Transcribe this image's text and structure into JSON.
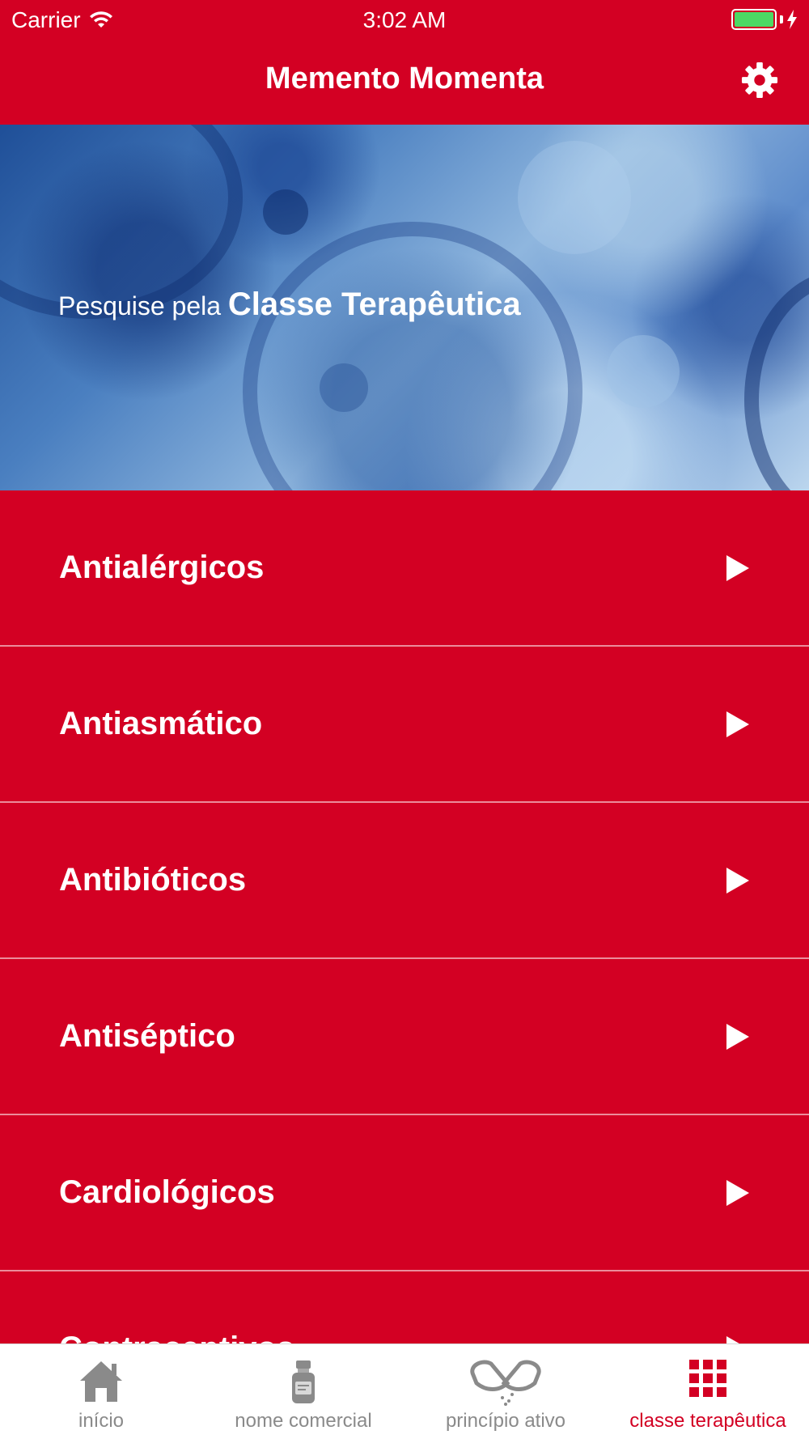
{
  "status_bar": {
    "carrier": "Carrier",
    "time": "3:02 AM"
  },
  "nav": {
    "title": "Memento Momenta",
    "settings_icon": "gear-icon"
  },
  "hero": {
    "prefix": "Pesquise pela",
    "emphasis": "Classe Terapêutica"
  },
  "list": {
    "items": [
      {
        "label": "Antialérgicos"
      },
      {
        "label": "Antiasmático"
      },
      {
        "label": "Antibióticos"
      },
      {
        "label": "Antiséptico"
      },
      {
        "label": "Cardiológicos"
      },
      {
        "label": "Contraceptivos"
      }
    ]
  },
  "tab_bar": {
    "tabs": [
      {
        "label": "início",
        "icon": "home-icon",
        "active": false
      },
      {
        "label": "nome comercial",
        "icon": "medicine-bottle-icon",
        "active": false
      },
      {
        "label": "princípio ativo",
        "icon": "capsule-icon",
        "active": false
      },
      {
        "label": "classe terapêutica",
        "icon": "grid-icon",
        "active": true
      }
    ]
  },
  "colors": {
    "brand_red": "#d30023",
    "battery_green": "#4cd964",
    "tab_inactive": "#8a8a8a"
  }
}
